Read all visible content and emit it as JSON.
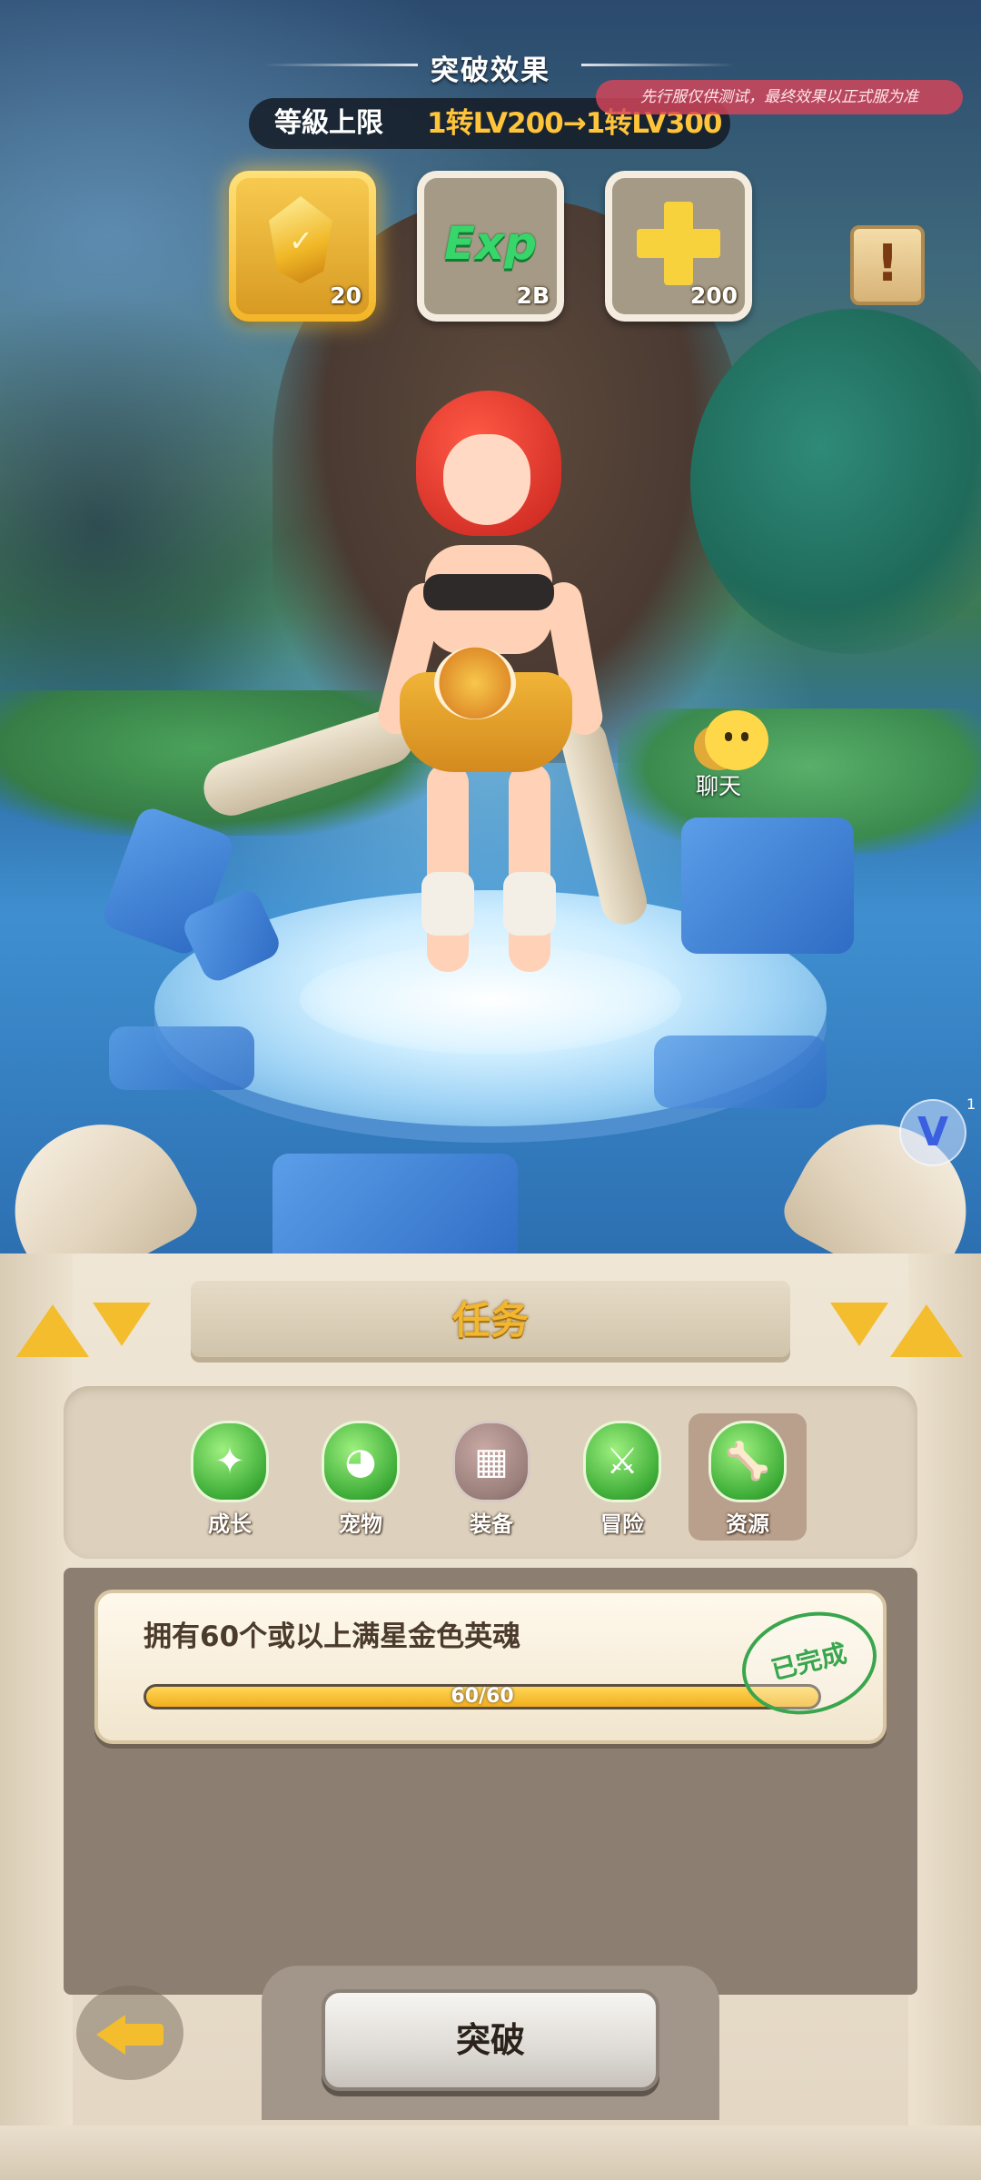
{
  "breakthrough_effect": {
    "title": "突破效果",
    "level_cap_label": "等級上限",
    "level_cap_value": "1转LV200→1转LV300",
    "test_notice": "先行服仅供测试，最终效果以正式服为准"
  },
  "rewards": [
    {
      "icon": "gold-crystal-icon",
      "count": "20",
      "highlighted": true
    },
    {
      "icon": "exp-icon",
      "label": "Exp",
      "count": "2B",
      "highlighted": false
    },
    {
      "icon": "gold-plus-icon",
      "count": "200",
      "highlighted": false
    }
  ],
  "chat": {
    "label": "聊天"
  },
  "v_badge": {
    "label": "V",
    "count": "1"
  },
  "task_panel": {
    "title": "任务",
    "tabs": [
      {
        "label": "成长",
        "icon": "growth-icon",
        "active": false,
        "enabled": true
      },
      {
        "label": "宠物",
        "icon": "pet-icon",
        "active": false,
        "enabled": true
      },
      {
        "label": "装备",
        "icon": "equipment-icon",
        "active": false,
        "enabled": false
      },
      {
        "label": "冒险",
        "icon": "adventure-icon",
        "active": false,
        "enabled": true
      },
      {
        "label": "资源",
        "icon": "resource-bone-icon",
        "active": true,
        "enabled": true
      }
    ],
    "tasks": [
      {
        "description": "拥有60个或以上满星金色英魂",
        "progress_text": "60/60",
        "progress": 1.0,
        "status": "已完成"
      }
    ],
    "action_button": "突破"
  },
  "colors": {
    "accent_gold": "#f4bd2e",
    "level_cap_value": "#ffc43a",
    "complete_green": "#39a64e",
    "notice_red": "#d7465a"
  }
}
